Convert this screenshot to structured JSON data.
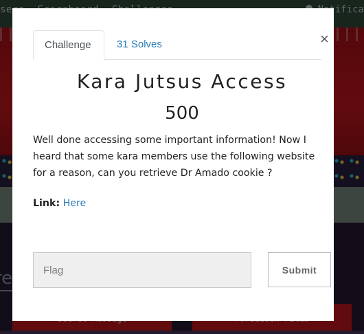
{
  "background": {
    "nav_items": [
      "sers",
      "Scoreboard",
      "Challenges"
    ],
    "notifications_label": "Notifica",
    "section_title_fragment": "re",
    "card_titles": [
      "Secret Message",
      "Forbidden Files"
    ]
  },
  "modal": {
    "tabs": [
      {
        "label": "Challenge",
        "active": true
      },
      {
        "label": "31 Solves",
        "active": false
      }
    ],
    "close_symbol": "×",
    "challenge_name": "Kara Jutsus Access",
    "challenge_value": "500",
    "description": "Well done accessing some important information! Now I heard that some kara members use the following website for a reason, can you retrieve Dr Amado cookie ?",
    "link_label": "Link:",
    "link_text": "Here",
    "flag_input": {
      "value": "",
      "placeholder": "Flag"
    },
    "submit_label": "Submit"
  },
  "colors": {
    "link": "#2a7ab8",
    "hero_red": "#c4161d",
    "topbar_green": "#2f4a3a"
  }
}
